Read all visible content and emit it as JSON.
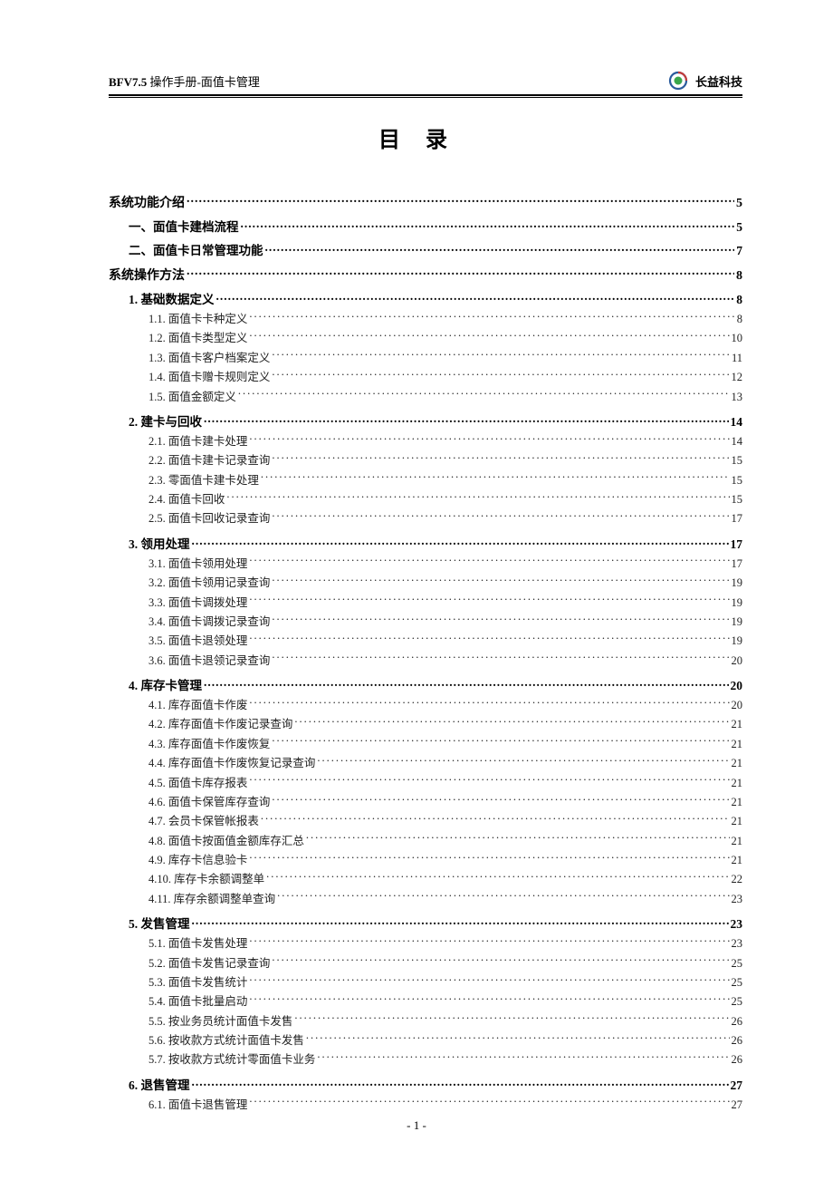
{
  "header": {
    "product": "BFV7.5",
    "subtitle": " 操作手册-面值卡管理",
    "company": "长益科技"
  },
  "title": "目录",
  "footer": "- 1 -",
  "toc": [
    {
      "level": 0,
      "label": "系统功能介绍",
      "page": "5"
    },
    {
      "level": 1,
      "label": "一、面值卡建档流程",
      "page": "5"
    },
    {
      "level": 1,
      "label": "二、面值卡日常管理功能",
      "page": "7"
    },
    {
      "level": 0,
      "label": "系统操作方法",
      "page": "8"
    },
    {
      "level": 1,
      "label": "1. 基础数据定义",
      "page": "8"
    },
    {
      "level": 2,
      "label": "1.1.  面值卡卡种定义",
      "page": "8"
    },
    {
      "level": 2,
      "label": "1.2.  面值卡类型定义",
      "page": "10"
    },
    {
      "level": 2,
      "label": "1.3.  面值卡客户档案定义",
      "page": "11"
    },
    {
      "level": 2,
      "label": "1.4.  面值卡赠卡规则定义",
      "page": "12"
    },
    {
      "level": 2,
      "label": "1.5.  面值金额定义",
      "page": "13"
    },
    {
      "level": 1,
      "label": "2. 建卡与回收",
      "page": "14"
    },
    {
      "level": 2,
      "label": "2.1.  面值卡建卡处理",
      "page": "14"
    },
    {
      "level": 2,
      "label": "2.2.  面值卡建卡记录查询",
      "page": "15"
    },
    {
      "level": 2,
      "label": "2.3.  零面值卡建卡处理",
      "page": "15"
    },
    {
      "level": 2,
      "label": "2.4.  面值卡回收",
      "page": "15"
    },
    {
      "level": 2,
      "label": "2.5.  面值卡回收记录查询",
      "page": "17"
    },
    {
      "level": 1,
      "label": "3. 领用处理",
      "page": "17"
    },
    {
      "level": 2,
      "label": "3.1.  面值卡领用处理",
      "page": "17"
    },
    {
      "level": 2,
      "label": "3.2.  面值卡领用记录查询",
      "page": "19"
    },
    {
      "level": 2,
      "label": "3.3.  面值卡调拨处理",
      "page": "19"
    },
    {
      "level": 2,
      "label": "3.4.  面值卡调拨记录查询",
      "page": "19"
    },
    {
      "level": 2,
      "label": "3.5.  面值卡退领处理",
      "page": "19"
    },
    {
      "level": 2,
      "label": "3.6.  面值卡退领记录查询",
      "page": "20"
    },
    {
      "level": 1,
      "label": "4. 库存卡管理",
      "page": "20"
    },
    {
      "level": 2,
      "label": "4.1.  库存面值卡作废",
      "page": "20"
    },
    {
      "level": 2,
      "label": "4.2.  库存面值卡作废记录查询",
      "page": "21"
    },
    {
      "level": 2,
      "label": "4.3.  库存面值卡作废恢复",
      "page": "21"
    },
    {
      "level": 2,
      "label": "4.4.  库存面值卡作废恢复记录查询",
      "page": "21"
    },
    {
      "level": 2,
      "label": "4.5.  面值卡库存报表",
      "page": "21"
    },
    {
      "level": 2,
      "label": "4.6.  面值卡保管库存查询",
      "page": "21"
    },
    {
      "level": 2,
      "label": "4.7.  会员卡保管帐报表",
      "page": "21"
    },
    {
      "level": 2,
      "label": "4.8.  面值卡按面值金额库存汇总",
      "page": "21"
    },
    {
      "level": 2,
      "label": "4.9.  库存卡信息验卡",
      "page": "21"
    },
    {
      "level": 2,
      "label": "4.10.  库存卡余额调整单",
      "page": "22"
    },
    {
      "level": 2,
      "label": "4.11.  库存余额调整单查询",
      "page": "23"
    },
    {
      "level": 1,
      "label": "5. 发售管理",
      "page": "23"
    },
    {
      "level": 2,
      "label": "5.1.  面值卡发售处理",
      "page": "23"
    },
    {
      "level": 2,
      "label": "5.2.  面值卡发售记录查询",
      "page": "25"
    },
    {
      "level": 2,
      "label": "5.3.  面值卡发售统计",
      "page": "25"
    },
    {
      "level": 2,
      "label": "5.4.  面值卡批量启动",
      "page": "25"
    },
    {
      "level": 2,
      "label": "5.5.  按业务员统计面值卡发售",
      "page": "26"
    },
    {
      "level": 2,
      "label": "5.6.  按收款方式统计面值卡发售",
      "page": "26"
    },
    {
      "level": 2,
      "label": "5.7.  按收款方式统计零面值卡业务",
      "page": "26"
    },
    {
      "level": 1,
      "label": "6. 退售管理",
      "page": "27"
    },
    {
      "level": 2,
      "label": "6.1.  面值卡退售管理",
      "page": "27"
    }
  ]
}
